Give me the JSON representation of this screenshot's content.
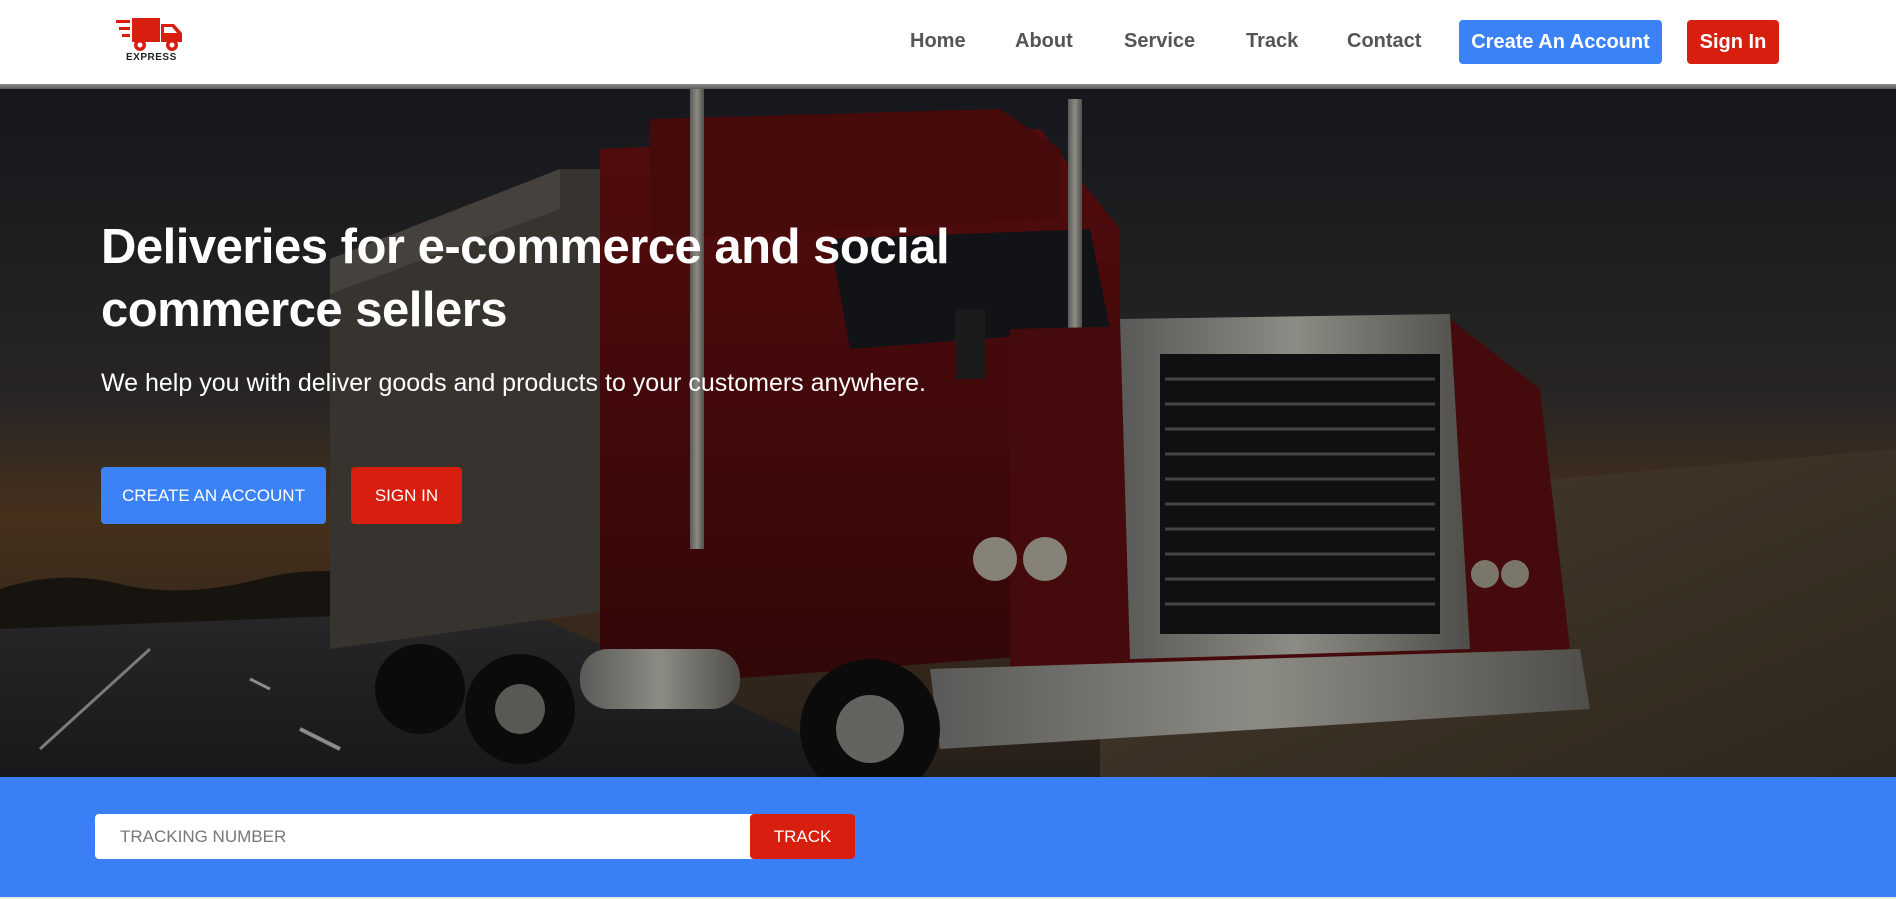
{
  "header": {
    "logo_text": "EXPRESS",
    "nav": [
      {
        "label": "Home"
      },
      {
        "label": "About"
      },
      {
        "label": "Service"
      },
      {
        "label": "Track"
      },
      {
        "label": "Contact"
      }
    ],
    "create_account_label": "Create An Account",
    "sign_in_label": "Sign In"
  },
  "hero": {
    "title": "Deliveries for e-commerce and social commerce sellers",
    "subtitle": "We help you with deliver goods and products to your customers anywhere.",
    "create_account_label": "CREATE AN ACCOUNT",
    "sign_in_label": "SIGN IN",
    "background_icon": "red-truck-on-highway-image"
  },
  "tracking": {
    "placeholder": "TRACKING NUMBER",
    "value": "",
    "button_label": "TRACK"
  },
  "colors": {
    "primary_blue": "#3b82f6",
    "accent_red": "#d71e0f",
    "band_blue": "#3b7ff7"
  }
}
